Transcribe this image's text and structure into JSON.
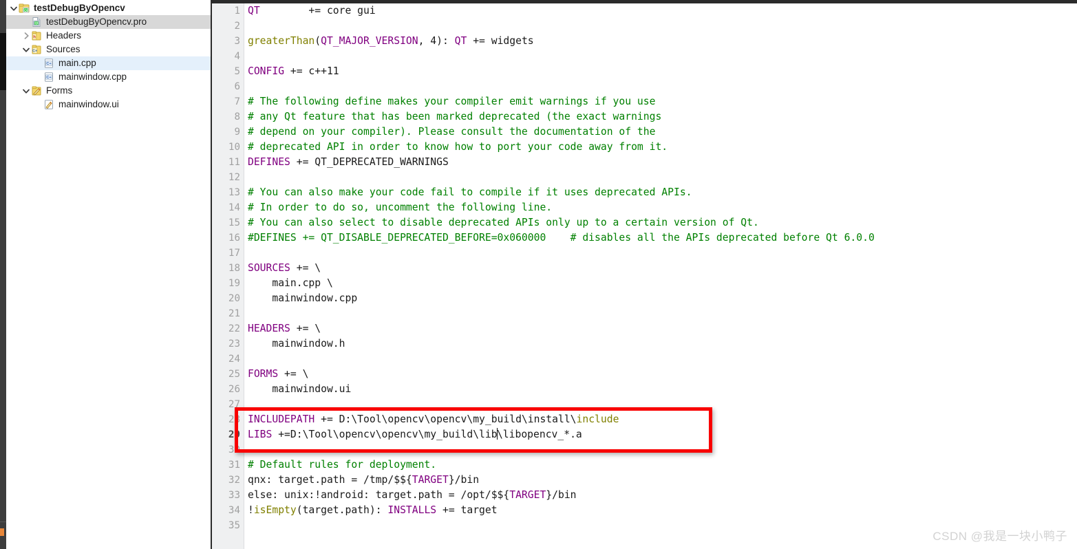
{
  "app": {
    "title": "Qt Creator project editor",
    "watermark": "CSDN @我是一块小鸭子"
  },
  "sidebar": {
    "items": [
      {
        "label": "testDebugByOpencv",
        "icon": "qt-project-icon",
        "indent": 0,
        "twisty": "expanded",
        "bold": true,
        "selected": "none"
      },
      {
        "label": "testDebugByOpencv.pro",
        "icon": "qt-pro-file-icon",
        "indent": 1,
        "twisty": "none",
        "bold": false,
        "selected": "gray"
      },
      {
        "label": "Headers",
        "icon": "headers-folder-icon",
        "indent": 1,
        "twisty": "collapsed",
        "bold": false,
        "selected": "none"
      },
      {
        "label": "Sources",
        "icon": "sources-folder-icon",
        "indent": 1,
        "twisty": "expanded",
        "bold": false,
        "selected": "none"
      },
      {
        "label": "main.cpp",
        "icon": "cpp-file-icon",
        "indent": 2,
        "twisty": "none",
        "bold": false,
        "selected": "blue"
      },
      {
        "label": "mainwindow.cpp",
        "icon": "cpp-file-icon",
        "indent": 2,
        "twisty": "none",
        "bold": false,
        "selected": "none"
      },
      {
        "label": "Forms",
        "icon": "forms-folder-icon",
        "indent": 1,
        "twisty": "expanded",
        "bold": false,
        "selected": "none"
      },
      {
        "label": "mainwindow.ui",
        "icon": "ui-file-icon",
        "indent": 2,
        "twisty": "none",
        "bold": false,
        "selected": "none"
      }
    ]
  },
  "editor": {
    "cursor_line": 29,
    "colors": {
      "variable": "#800080",
      "function": "#808000",
      "comment": "#008000",
      "plain": "#1a1a1a",
      "line_number": "#a0a0a0",
      "gutter_bg": "#eff0f1",
      "highlight_box": "#f90000"
    },
    "lines": [
      {
        "n": 1,
        "tokens": [
          {
            "t": "QT",
            "c": "var"
          },
          {
            "t": "        += core gui",
            "c": "txt"
          }
        ]
      },
      {
        "n": 2,
        "tokens": []
      },
      {
        "n": 3,
        "tokens": [
          {
            "t": "greaterThan",
            "c": "fn"
          },
          {
            "t": "(",
            "c": "txt"
          },
          {
            "t": "QT_MAJOR_VERSION",
            "c": "var"
          },
          {
            "t": ", 4): ",
            "c": "txt"
          },
          {
            "t": "QT",
            "c": "var"
          },
          {
            "t": " += widgets",
            "c": "txt"
          }
        ]
      },
      {
        "n": 4,
        "tokens": []
      },
      {
        "n": 5,
        "tokens": [
          {
            "t": "CONFIG",
            "c": "var"
          },
          {
            "t": " += c++11",
            "c": "txt"
          }
        ]
      },
      {
        "n": 6,
        "tokens": []
      },
      {
        "n": 7,
        "tokens": [
          {
            "t": "# The following define makes your compiler emit warnings if you use",
            "c": "cmt"
          }
        ]
      },
      {
        "n": 8,
        "tokens": [
          {
            "t": "# any Qt feature that has been marked deprecated (the exact warnings",
            "c": "cmt"
          }
        ]
      },
      {
        "n": 9,
        "tokens": [
          {
            "t": "# depend on your compiler). Please consult the documentation of the",
            "c": "cmt"
          }
        ]
      },
      {
        "n": 10,
        "tokens": [
          {
            "t": "# deprecated API in order to know how to port your code away from it.",
            "c": "cmt"
          }
        ]
      },
      {
        "n": 11,
        "tokens": [
          {
            "t": "DEFINES",
            "c": "var"
          },
          {
            "t": " += QT_DEPRECATED_WARNINGS",
            "c": "txt"
          }
        ]
      },
      {
        "n": 12,
        "tokens": []
      },
      {
        "n": 13,
        "tokens": [
          {
            "t": "# You can also make your code fail to compile if it uses deprecated APIs.",
            "c": "cmt"
          }
        ]
      },
      {
        "n": 14,
        "tokens": [
          {
            "t": "# In order to do so, uncomment the following line.",
            "c": "cmt"
          }
        ]
      },
      {
        "n": 15,
        "tokens": [
          {
            "t": "# You can also select to disable deprecated APIs only up to a certain version of Qt.",
            "c": "cmt"
          }
        ]
      },
      {
        "n": 16,
        "tokens": [
          {
            "t": "#DEFINES += QT_DISABLE_DEPRECATED_BEFORE=0x060000    # disables all the APIs deprecated before Qt 6.0.0",
            "c": "cmt"
          }
        ]
      },
      {
        "n": 17,
        "tokens": []
      },
      {
        "n": 18,
        "tokens": [
          {
            "t": "SOURCES",
            "c": "var"
          },
          {
            "t": " += \\",
            "c": "txt"
          }
        ]
      },
      {
        "n": 19,
        "tokens": [
          {
            "t": "    main.cpp \\",
            "c": "txt"
          }
        ]
      },
      {
        "n": 20,
        "tokens": [
          {
            "t": "    mainwindow.cpp",
            "c": "txt"
          }
        ]
      },
      {
        "n": 21,
        "tokens": []
      },
      {
        "n": 22,
        "tokens": [
          {
            "t": "HEADERS",
            "c": "var"
          },
          {
            "t": " += \\",
            "c": "txt"
          }
        ]
      },
      {
        "n": 23,
        "tokens": [
          {
            "t": "    mainwindow.h",
            "c": "txt"
          }
        ]
      },
      {
        "n": 24,
        "tokens": []
      },
      {
        "n": 25,
        "tokens": [
          {
            "t": "FORMS",
            "c": "var"
          },
          {
            "t": " += \\",
            "c": "txt"
          }
        ]
      },
      {
        "n": 26,
        "tokens": [
          {
            "t": "    mainwindow.ui",
            "c": "txt"
          }
        ]
      },
      {
        "n": 27,
        "tokens": []
      },
      {
        "n": 28,
        "tokens": [
          {
            "t": "INCLUDEPATH",
            "c": "var"
          },
          {
            "t": " += D:\\Tool\\opencv\\opencv\\my_build\\install\\",
            "c": "txt"
          },
          {
            "t": "include",
            "c": "fn"
          }
        ]
      },
      {
        "n": 29,
        "tokens": [
          {
            "t": "LIBS",
            "c": "var"
          },
          {
            "t": " +=D:\\Tool\\opencv\\opencv\\my_build\\lib",
            "c": "txt"
          },
          {
            "t": "",
            "c": "caret"
          },
          {
            "t": "\\libopencv_*.a",
            "c": "txt"
          }
        ]
      },
      {
        "n": 30,
        "tokens": []
      },
      {
        "n": 31,
        "tokens": [
          {
            "t": "# Default rules for deployment.",
            "c": "cmt"
          }
        ]
      },
      {
        "n": 32,
        "tokens": [
          {
            "t": "qnx: target.path = /tmp/$${",
            "c": "txt"
          },
          {
            "t": "TARGET",
            "c": "var"
          },
          {
            "t": "}/bin",
            "c": "txt"
          }
        ]
      },
      {
        "n": 33,
        "tokens": [
          {
            "t": "else: unix:!android: target.path = /opt/$${",
            "c": "txt"
          },
          {
            "t": "TARGET",
            "c": "var"
          },
          {
            "t": "}/bin",
            "c": "txt"
          }
        ]
      },
      {
        "n": 34,
        "tokens": [
          {
            "t": "!",
            "c": "txt"
          },
          {
            "t": "isEmpty",
            "c": "fn"
          },
          {
            "t": "(target.path): ",
            "c": "txt"
          },
          {
            "t": "INSTALLS",
            "c": "var"
          },
          {
            "t": " += target",
            "c": "txt"
          }
        ]
      },
      {
        "n": 35,
        "tokens": []
      }
    ]
  },
  "highlight": {
    "label": "red-annotation-box",
    "covers_lines": [
      28,
      29
    ]
  }
}
